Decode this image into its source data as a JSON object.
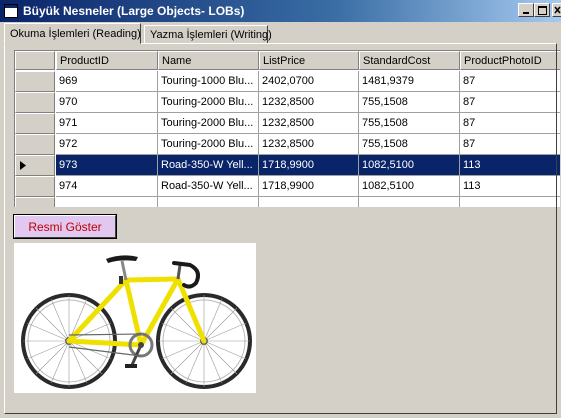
{
  "window": {
    "title": "Büyük Nesneler (Large Objects- LOBs)",
    "icon": "app-form-icon",
    "controls": [
      "minimize-icon",
      "maximize-icon",
      "close-icon"
    ]
  },
  "tabs": [
    {
      "label": "Okuma İşlemleri (Reading)",
      "active": true
    },
    {
      "label": "Yazma İşlemleri (Writing)",
      "active": false
    }
  ],
  "grid": {
    "columns": [
      "ProductID",
      "Name",
      "ListPrice",
      "StandardCost",
      "ProductPhotoID"
    ],
    "rows": [
      {
        "ProductID": "969",
        "Name": "Touring-1000 Blu...",
        "ListPrice": "2402,0700",
        "StandardCost": "1481,9379",
        "ProductPhotoID": "87",
        "selected": false
      },
      {
        "ProductID": "970",
        "Name": "Touring-2000 Blu...",
        "ListPrice": "1232,8500",
        "StandardCost": "755,1508",
        "ProductPhotoID": "87",
        "selected": false
      },
      {
        "ProductID": "971",
        "Name": "Touring-2000 Blu...",
        "ListPrice": "1232,8500",
        "StandardCost": "755,1508",
        "ProductPhotoID": "87",
        "selected": false
      },
      {
        "ProductID": "972",
        "Name": "Touring-2000 Blu...",
        "ListPrice": "1232,8500",
        "StandardCost": "755,1508",
        "ProductPhotoID": "87",
        "selected": false
      },
      {
        "ProductID": "973",
        "Name": "Road-350-W Yell...",
        "ListPrice": "1718,9900",
        "StandardCost": "1082,5100",
        "ProductPhotoID": "113",
        "selected": true
      },
      {
        "ProductID": "974",
        "Name": "Road-350-W Yell...",
        "ListPrice": "1718,9900",
        "StandardCost": "1082,5100",
        "ProductPhotoID": "113",
        "selected": false
      }
    ],
    "selection_color": "#0a246a"
  },
  "show_button": {
    "label": "Resmi Göster",
    "text_color": "#c00000",
    "background": "#e0c8f0"
  },
  "photo": {
    "subject": "yellow road bicycle",
    "frame_color": "#f0e000"
  }
}
